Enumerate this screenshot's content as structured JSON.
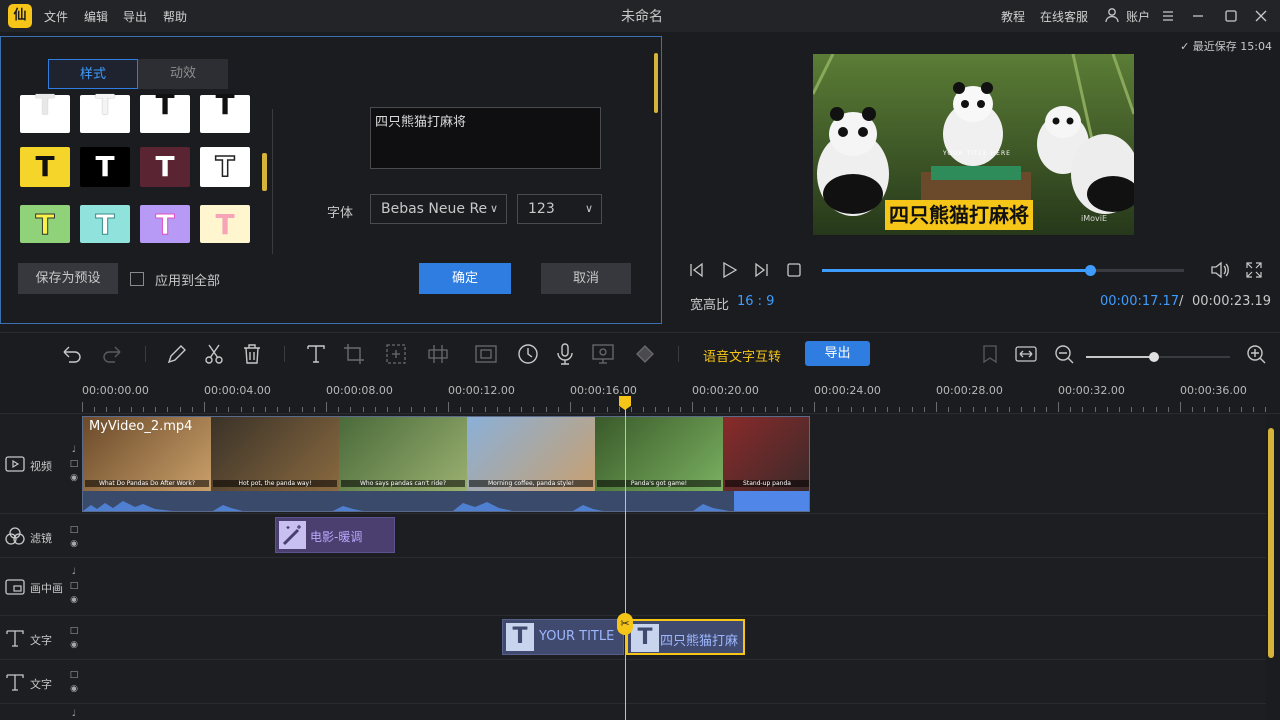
{
  "titlebar": {
    "logo_glyph": "仙",
    "menu": [
      "文件",
      "编辑",
      "导出",
      "帮助"
    ],
    "title": "未命名",
    "tutorial": "教程",
    "support": "在线客服",
    "account": "账户"
  },
  "editor": {
    "tabs": {
      "style": "样式",
      "animation": "动效"
    },
    "text_value": "四只熊猫打麻将",
    "font_label": "字体",
    "font_value": "Bebas Neue Re",
    "size_value": "123",
    "save_preset": "保存为预设",
    "apply_all": "应用到全部",
    "ok": "确定",
    "cancel": "取消",
    "swatch_glyph": "T"
  },
  "preview": {
    "last_saved": "最近保存 15:04",
    "overlay_small": "YOUR TITLE HERE",
    "overlay_caption": "四只熊猫打麻将",
    "watermark": "iMoviE",
    "ratio_label": "宽高比",
    "ratio_value": "16 : 9",
    "time_current": "00:00:17.17",
    "time_sep": "/",
    "time_total": "00:00:23.19",
    "progress": 0.74
  },
  "toolbar": {
    "speech_text": "语音文字互转",
    "export": "导出"
  },
  "ruler": {
    "ticks": [
      "00:00:00.00",
      "00:00:04.00",
      "00:00:08.00",
      "00:00:12.00",
      "00:00:16.00",
      "00:00:20.00",
      "00:00:24.00",
      "00:00:28.00",
      "00:00:32.00",
      "00:00:36.00"
    ]
  },
  "tracks": {
    "video_label": "视频",
    "filter_label": "滤镜",
    "pip_label": "画中画",
    "text_label": "文字",
    "text2_label": "文字",
    "video_clip_name": "MyVideo_2.mp4",
    "captions": [
      "What Do Pandas Do After Work?",
      "Hot pot, the panda way!",
      "Who says pandas can't ride?",
      "Morning coffee, panda style!",
      "Panda's got game!",
      "Stand-up panda"
    ],
    "filter_clip": "电影-暖调",
    "text_clip_1": "YOUR TITLE",
    "text_clip_2": "四只熊猫打麻"
  },
  "colors": {
    "accent": "#2f7de1",
    "highlight": "#f5c518",
    "bg": "#1b1c20"
  }
}
